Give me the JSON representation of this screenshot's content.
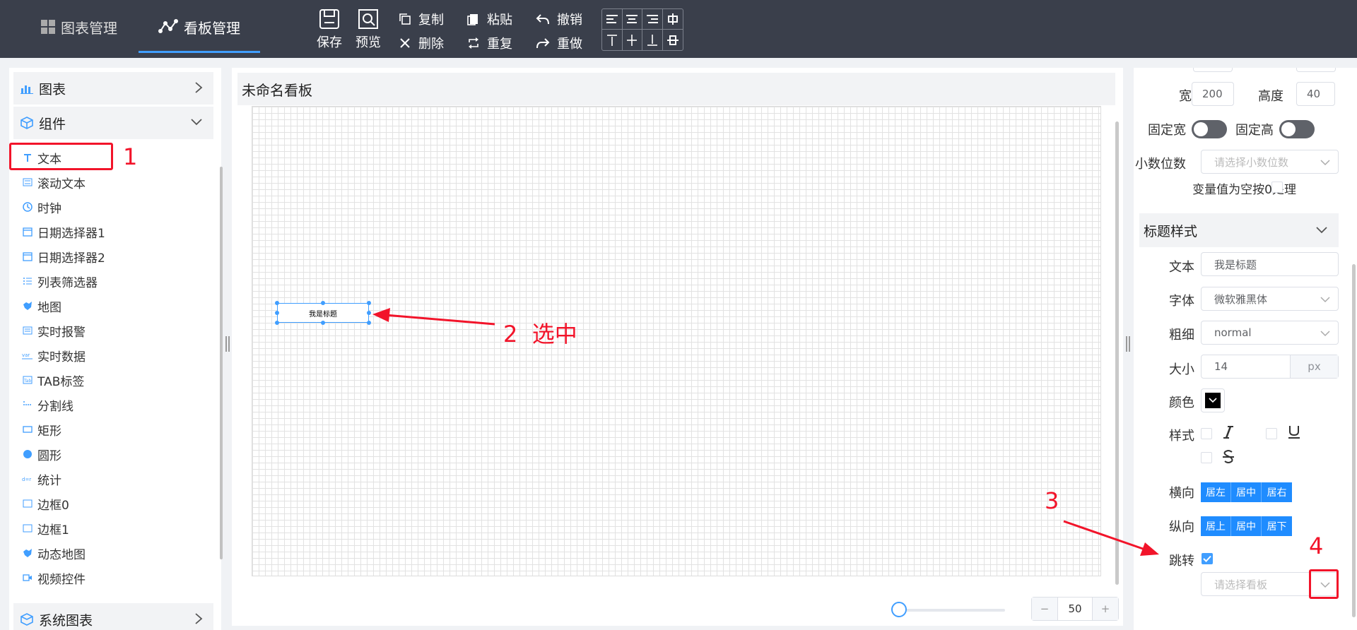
{
  "topnav": {
    "tabs": [
      {
        "label": "图表管理",
        "icon": "grid-icon"
      },
      {
        "label": "看板管理",
        "icon": "share-icon",
        "active": true
      }
    ],
    "tools": {
      "save": "保存",
      "preview": "预览",
      "copy": "复制",
      "delete": "删除",
      "paste": "粘贴",
      "repeat": "重复",
      "undo": "撤销",
      "redo": "重做"
    }
  },
  "sidebar": {
    "groups": [
      {
        "label": "图表",
        "icon": "bar-chart-icon",
        "expanded": false
      },
      {
        "label": "组件",
        "icon": "cube-icon",
        "expanded": true
      },
      {
        "label": "系统图表",
        "icon": "cube-icon",
        "expanded": false
      }
    ],
    "components": [
      {
        "label": "文本",
        "icon": "text-icon"
      },
      {
        "label": "滚动文本",
        "icon": "scroll-text-icon"
      },
      {
        "label": "时钟",
        "icon": "clock-icon"
      },
      {
        "label": "日期选择器1",
        "icon": "calendar-icon"
      },
      {
        "label": "日期选择器2",
        "icon": "calendar-icon"
      },
      {
        "label": "列表筛选器",
        "icon": "list-icon"
      },
      {
        "label": "地图",
        "icon": "map-icon"
      },
      {
        "label": "实时报警",
        "icon": "alarm-icon"
      },
      {
        "label": "实时数据",
        "icon": "var-icon"
      },
      {
        "label": "TAB标签",
        "icon": "tab-icon"
      },
      {
        "label": "分割线",
        "icon": "divider-icon"
      },
      {
        "label": "矩形",
        "icon": "rectangle-icon"
      },
      {
        "label": "圆形",
        "icon": "circle-icon"
      },
      {
        "label": "统计",
        "icon": "stat-icon"
      },
      {
        "label": "边框0",
        "icon": "border-icon"
      },
      {
        "label": "边框1",
        "icon": "border-icon"
      },
      {
        "label": "动态地图",
        "icon": "map-icon"
      },
      {
        "label": "视频控件",
        "icon": "video-icon"
      }
    ]
  },
  "board": {
    "title": "未命名看板",
    "selected_widget_text": "我是标题",
    "zoom_value": "50",
    "zoom_minus": "−",
    "zoom_plus": "+"
  },
  "properties": {
    "width_label": "宽度",
    "width_value": "200",
    "height_label": "高度",
    "height_value": "40",
    "fixed_width_label": "固定宽",
    "fixed_height_label": "固定高",
    "decimal_label": "小数位数",
    "decimal_placeholder": "请选择小数位数",
    "null_zero_label": "变量值为空按0处理",
    "title_style_header": "标题样式",
    "text_label": "文本",
    "text_value": "我是标题",
    "font_label": "字体",
    "font_value": "微软雅黑体",
    "weight_label": "粗细",
    "weight_value": "normal",
    "size_label": "大小",
    "size_value": "14",
    "size_unit": "px",
    "color_label": "颜色",
    "color_value": "#000000",
    "style_label": "样式",
    "h_align_label": "横向",
    "h_align_options": [
      "居左",
      "居中",
      "居右"
    ],
    "v_align_label": "纵向",
    "v_align_options": [
      "居上",
      "居中",
      "居下"
    ],
    "jump_label": "跳转",
    "jump_checked": true,
    "board_select_placeholder": "请选择看板"
  },
  "annotations": {
    "step1": "1",
    "step2": "2  选中",
    "step3": "3",
    "step4": "4"
  },
  "colors": {
    "accent": "#409eff",
    "annotation_red": "#f2142a",
    "topbar": "#3a3f4b"
  }
}
